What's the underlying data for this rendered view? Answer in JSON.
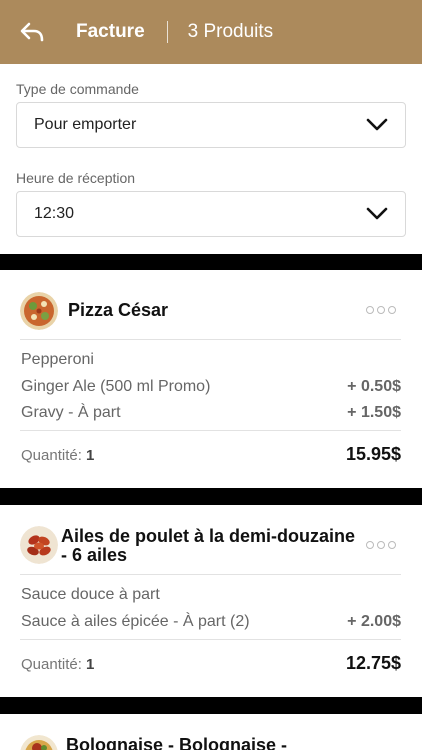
{
  "header": {
    "title": "Facture",
    "product_count": "3 Produits",
    "back_icon": "reply-arrow-icon",
    "color": "#ac8a5c"
  },
  "form": {
    "order_type": {
      "label": "Type de commande",
      "value": "Pour emporter"
    },
    "pickup_time": {
      "label": "Heure de réception",
      "value": "12:30"
    }
  },
  "cart": {
    "items": [
      {
        "name": "Pizza César",
        "options": [
          {
            "label": "Pepperoni",
            "price": ""
          },
          {
            "label": "Ginger Ale (500 ml Promo)",
            "price": "+ 0.50$"
          },
          {
            "label": "Gravy - À part",
            "price": "+ 1.50$"
          }
        ],
        "quantity_label": "Quantité:",
        "quantity": "1",
        "total": "15.95$"
      },
      {
        "name_line1": "Ailes de poulet à la demi-douzaine",
        "name_line2": "- 6 ailes",
        "options": [
          {
            "label": "Sauce douce à part",
            "price": ""
          },
          {
            "label": "Sauce à ailes épicée - À part (2)",
            "price": "+ 2.00$"
          }
        ],
        "quantity_label": "Quantité:",
        "quantity": "1",
        "total": "12.75$"
      },
      {
        "name": "Bolognaise - Bolognaise -"
      }
    ]
  }
}
